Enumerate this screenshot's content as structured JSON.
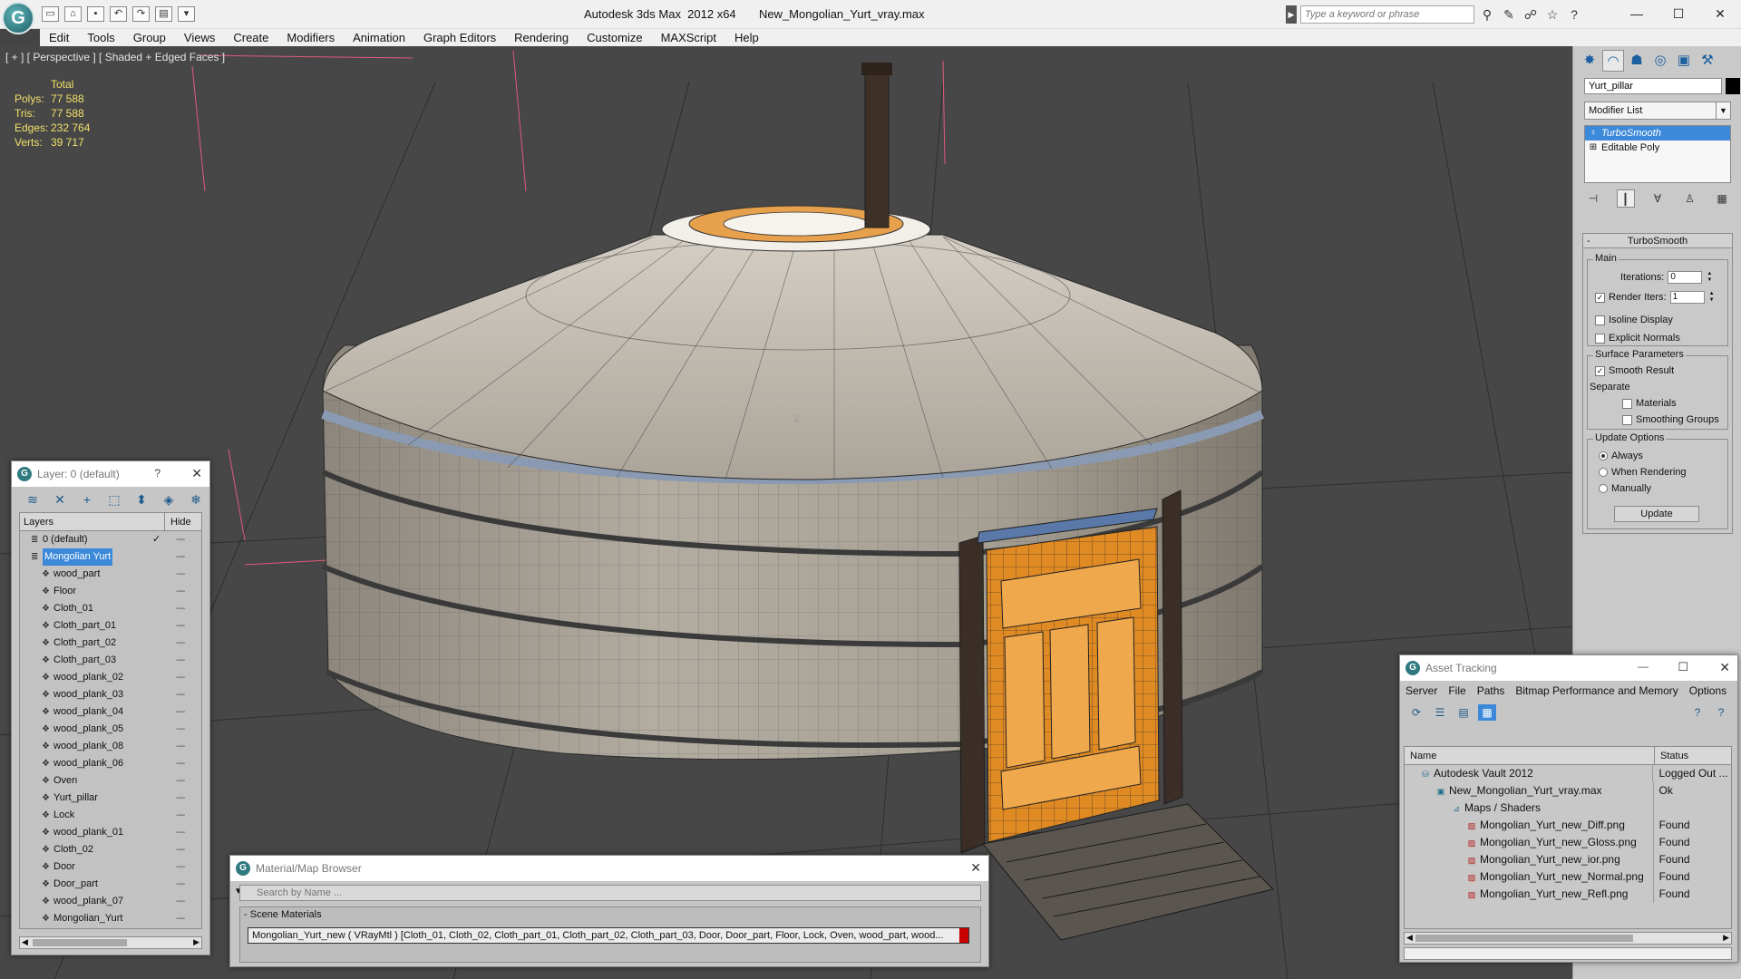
{
  "window": {
    "title": "Autodesk 3ds Max  2012 x64       New_Mongolian_Yurt_vray.max",
    "search_placeholder": "Type a keyword or phrase",
    "minimize": "—",
    "maximize": "☐",
    "close": "✕"
  },
  "menu": [
    "Edit",
    "Tools",
    "Group",
    "Views",
    "Create",
    "Modifiers",
    "Animation",
    "Graph Editors",
    "Rendering",
    "Customize",
    "MAXScript",
    "Help"
  ],
  "viewport": {
    "label": "[ + ] [ Perspective ] [ Shaded + Edged Faces ]",
    "stats_header": "Total",
    "stats": [
      {
        "key": "Polys:",
        "value": "77 588"
      },
      {
        "key": "Tris:",
        "value": "77 588"
      },
      {
        "key": "Edges:",
        "value": "232 764"
      },
      {
        "key": "Verts:",
        "value": "39 717"
      }
    ],
    "axis_label": "Z"
  },
  "command_panel": {
    "object_name": "Yurt_pillar",
    "modifier_list": "Modifier List",
    "stack": [
      {
        "label": "TurboSmooth",
        "selected": true
      },
      {
        "label": "Editable Poly",
        "selected": false
      }
    ],
    "rollout_title": "TurboSmooth",
    "main_group": "Main",
    "iterations_label": "Iterations:",
    "iterations_value": "0",
    "render_iters_label": "Render Iters:",
    "render_iters_value": "1",
    "isoline_label": "Isoline Display",
    "explicit_normals_label": "Explicit Normals",
    "surface_group": "Surface Parameters",
    "smooth_result_label": "Smooth Result",
    "separate_label": "Separate",
    "materials_label": "Materials",
    "smoothing_groups_label": "Smoothing Groups",
    "update_group": "Update Options",
    "always_label": "Always",
    "when_rendering_label": "When Rendering",
    "manually_label": "Manually",
    "update_button": "Update"
  },
  "layer_window": {
    "title": "Layer: 0 (default)",
    "help": "?",
    "close": "✕",
    "col_layers": "Layers",
    "col_hide": "Hide",
    "rows": [
      {
        "name": "0 (default)",
        "indent": 1,
        "kind": "layer",
        "check": "✓"
      },
      {
        "name": "Mongolian Yurt",
        "indent": 1,
        "kind": "layer",
        "selected": true
      },
      {
        "name": "wood_part",
        "indent": 2
      },
      {
        "name": "Floor",
        "indent": 2
      },
      {
        "name": "Cloth_01",
        "indent": 2
      },
      {
        "name": "Cloth_part_01",
        "indent": 2
      },
      {
        "name": "Cloth_part_02",
        "indent": 2
      },
      {
        "name": "Cloth_part_03",
        "indent": 2
      },
      {
        "name": "wood_plank_02",
        "indent": 2
      },
      {
        "name": "wood_plank_03",
        "indent": 2
      },
      {
        "name": "wood_plank_04",
        "indent": 2
      },
      {
        "name": "wood_plank_05",
        "indent": 2
      },
      {
        "name": "wood_plank_08",
        "indent": 2
      },
      {
        "name": "wood_plank_06",
        "indent": 2
      },
      {
        "name": "Oven",
        "indent": 2
      },
      {
        "name": "Yurt_pillar",
        "indent": 2
      },
      {
        "name": "Lock",
        "indent": 2
      },
      {
        "name": "wood_plank_01",
        "indent": 2
      },
      {
        "name": "Cloth_02",
        "indent": 2
      },
      {
        "name": "Door",
        "indent": 2
      },
      {
        "name": "Door_part",
        "indent": 2
      },
      {
        "name": "wood_plank_07",
        "indent": 2
      },
      {
        "name": "Mongolian_Yurt",
        "indent": 2
      }
    ]
  },
  "material_window": {
    "title": "Material/Map Browser",
    "close": "✕",
    "search_placeholder": "Search by Name ...",
    "group": "Scene Materials",
    "entry": "Mongolian_Yurt_new  ( VRayMtl )  [Cloth_01, Cloth_02, Cloth_part_01, Cloth_part_02, Cloth_part_03, Door, Door_part, Floor, Lock, Oven, wood_part, wood..."
  },
  "asset_window": {
    "title": "Asset Tracking",
    "minimize": "—",
    "maximize": "☐",
    "close": "✕",
    "menu": [
      "Server",
      "File",
      "Paths",
      "Bitmap Performance and Memory",
      "Options"
    ],
    "col_name": "Name",
    "col_status": "Status",
    "rows": [
      {
        "name": "Autodesk Vault 2012",
        "status": "Logged Out ...",
        "indent": 1,
        "icon": "vault"
      },
      {
        "name": "New_Mongolian_Yurt_vray.max",
        "status": "Ok",
        "indent": 2,
        "icon": "max"
      },
      {
        "name": "Maps / Shaders",
        "status": "",
        "indent": 3,
        "icon": "maps"
      },
      {
        "name": "Mongolian_Yurt_new_Diff.png",
        "status": "Found",
        "indent": 4,
        "icon": "png"
      },
      {
        "name": "Mongolian_Yurt_new_Gloss.png",
        "status": "Found",
        "indent": 4,
        "icon": "png"
      },
      {
        "name": "Mongolian_Yurt_new_ior.png",
        "status": "Found",
        "indent": 4,
        "icon": "png"
      },
      {
        "name": "Mongolian_Yurt_new_Normal.png",
        "status": "Found",
        "indent": 4,
        "icon": "png"
      },
      {
        "name": "Mongolian_Yurt_new_Refl.png",
        "status": "Found",
        "indent": 4,
        "icon": "png"
      }
    ]
  },
  "colors": {
    "viewport_bg": "#474747",
    "stats_yellow": "#f1e06a",
    "selection_blue": "#3c89d9",
    "door_orange": "#e08a24"
  }
}
